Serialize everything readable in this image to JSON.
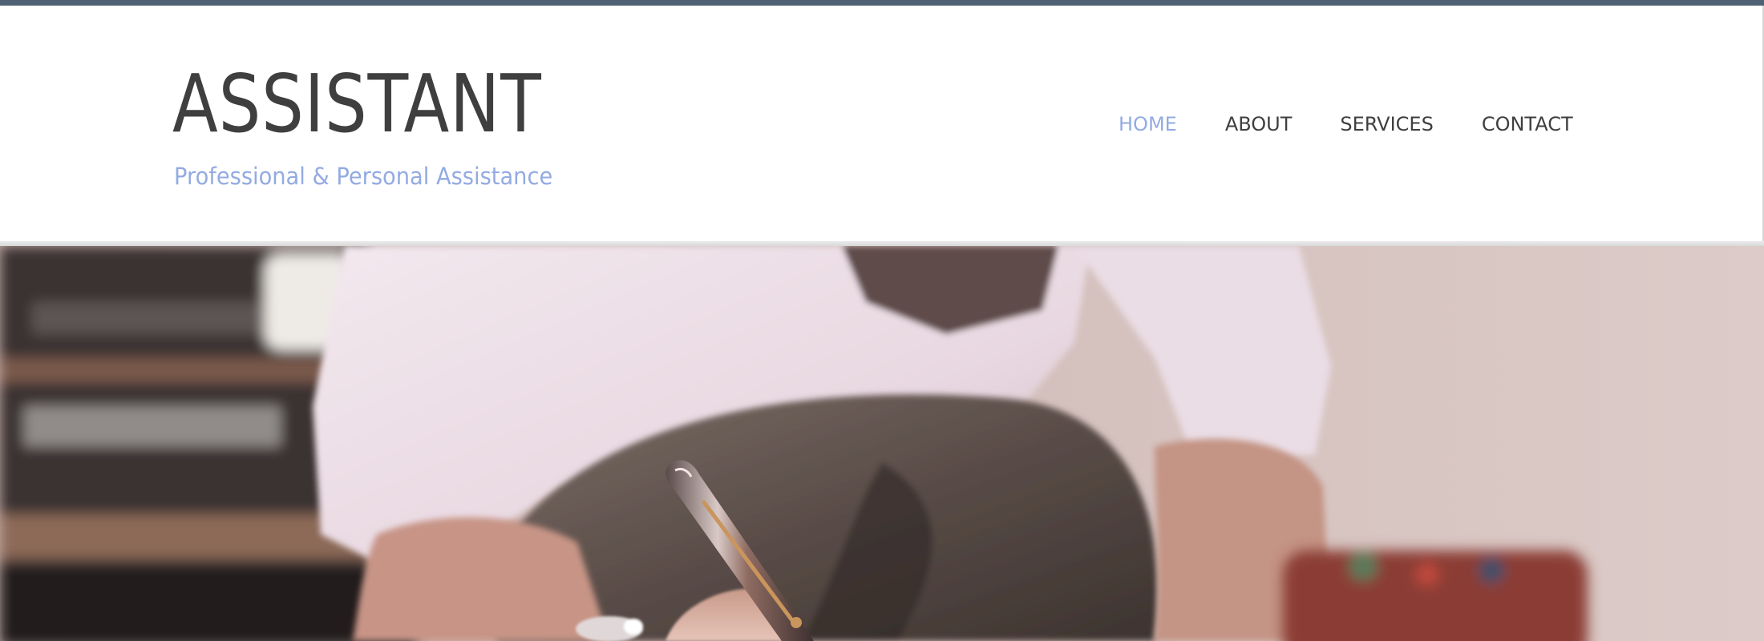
{
  "site": {
    "title": "ASSISTANT",
    "tagline": "Professional & Personal Assistance"
  },
  "nav": {
    "items": [
      {
        "label": "HOME",
        "active": true
      },
      {
        "label": "ABOUT",
        "active": false
      },
      {
        "label": "SERVICES",
        "active": false
      },
      {
        "label": "CONTACT",
        "active": false
      }
    ]
  },
  "colors": {
    "top_bar": "#4e6274",
    "accent": "#93abe2",
    "text": "#3f3f3f"
  },
  "hero": {
    "image_subject": "person-writing-with-pen"
  }
}
